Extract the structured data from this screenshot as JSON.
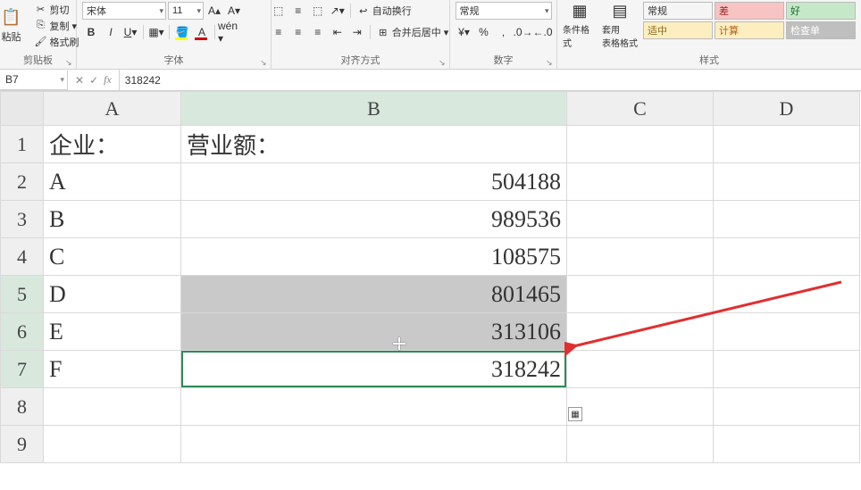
{
  "ribbon": {
    "clipboard": {
      "paste": "粘贴",
      "cut": "剪切",
      "copy": "复制 ▾",
      "format_painter": "格式刷",
      "label": "剪贴板"
    },
    "font": {
      "name": "宋体",
      "size": "11",
      "label": "字体"
    },
    "alignment": {
      "wrap": "自动换行",
      "merge": "合并后居中 ▾",
      "label": "对齐方式"
    },
    "number": {
      "format": "常规",
      "label": "数字"
    },
    "styles": {
      "cond_format": "条件格式",
      "table_format": "套用\n表格格式",
      "cells": {
        "normal": "常规",
        "bad": "差",
        "good": "好",
        "moderate": "适中",
        "calc": "计算",
        "check": "检查单"
      },
      "label": "样式"
    }
  },
  "formula_bar": {
    "cell_ref": "B7",
    "value": "318242"
  },
  "columns": [
    "A",
    "B",
    "C",
    "D"
  ],
  "row_numbers": [
    "1",
    "2",
    "3",
    "4",
    "5",
    "6",
    "7",
    "8",
    "9"
  ],
  "headers": {
    "A": "企业：",
    "B": "营业额："
  },
  "rows": [
    {
      "a": "A",
      "b": "504188"
    },
    {
      "a": "B",
      "b": "989536"
    },
    {
      "a": "C",
      "b": "108575"
    },
    {
      "a": "D",
      "b": "801465"
    },
    {
      "a": "E",
      "b": "313106"
    },
    {
      "a": "F",
      "b": "318242"
    }
  ],
  "colors": {
    "style_bad_bg": "#f7c3c3",
    "style_bad_fg": "#a02020",
    "style_good_bg": "#c5e8c9",
    "style_good_fg": "#1d6b2b",
    "style_mod_bg": "#fdeec0",
    "style_mod_fg": "#8a6a1a",
    "style_calc_bg": "#fdeec0",
    "style_calc_fg": "#b85e12",
    "style_check_bg": "#bfbfbf",
    "style_check_fg": "#fff"
  }
}
